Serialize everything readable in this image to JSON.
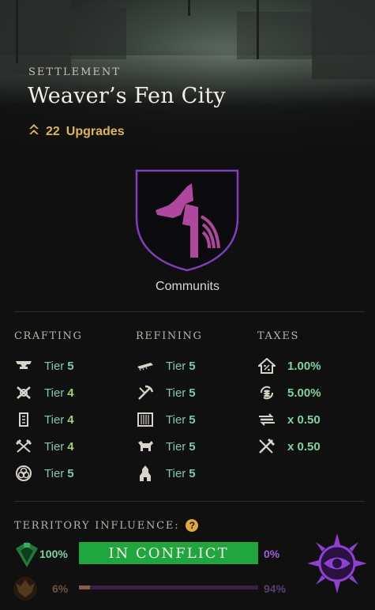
{
  "header": {
    "label": "SETTLEMENT",
    "city_name": "Weaver’s Fen City",
    "upgrades_count": "22",
    "upgrades_label": "Upgrades"
  },
  "company": {
    "name": "Communits",
    "crest_color": "#9a3a9a"
  },
  "crafting": {
    "title": "CRAFTING",
    "items": [
      {
        "icon": "anvil-icon",
        "prefix": "Tier",
        "tier": "5"
      },
      {
        "icon": "crossed-hammers-icon",
        "prefix": "Tier",
        "tier": "4"
      },
      {
        "icon": "scroll-icon",
        "prefix": "Tier",
        "tier": "4"
      },
      {
        "icon": "crossed-tools-icon",
        "prefix": "Tier",
        "tier": "4"
      },
      {
        "icon": "arcane-circle-icon",
        "prefix": "Tier",
        "tier": "5"
      }
    ]
  },
  "refining": {
    "title": "REFINING",
    "items": [
      {
        "icon": "saw-blade-icon",
        "prefix": "Tier",
        "tier": "5"
      },
      {
        "icon": "pickaxe-hammer-icon",
        "prefix": "Tier",
        "tier": "5"
      },
      {
        "icon": "loom-icon",
        "prefix": "Tier",
        "tier": "5"
      },
      {
        "icon": "tannery-icon",
        "prefix": "Tier",
        "tier": "5"
      },
      {
        "icon": "smelter-icon",
        "prefix": "Tier",
        "tier": "5"
      }
    ]
  },
  "taxes": {
    "title": "TAXES",
    "items": [
      {
        "icon": "house-percent-icon",
        "value": "1.00%"
      },
      {
        "icon": "coins-cycle-icon",
        "value": "5.00%"
      },
      {
        "icon": "trade-arrows-icon",
        "value": "x 0.50"
      },
      {
        "icon": "crafting-fee-icon",
        "value": "x 0.50"
      }
    ]
  },
  "territory": {
    "label": "TERRITORY INFLUENCE:",
    "help": "?",
    "primary": {
      "left_pct": "100%",
      "status": "IN CONFLICT",
      "right_pct": "0%",
      "color": "#1fa63c"
    },
    "secondary": {
      "left_pct": "6%",
      "right_pct": "94%",
      "fill_fraction": 0.06
    },
    "faction_emblem_color": "#8f3fd1"
  }
}
